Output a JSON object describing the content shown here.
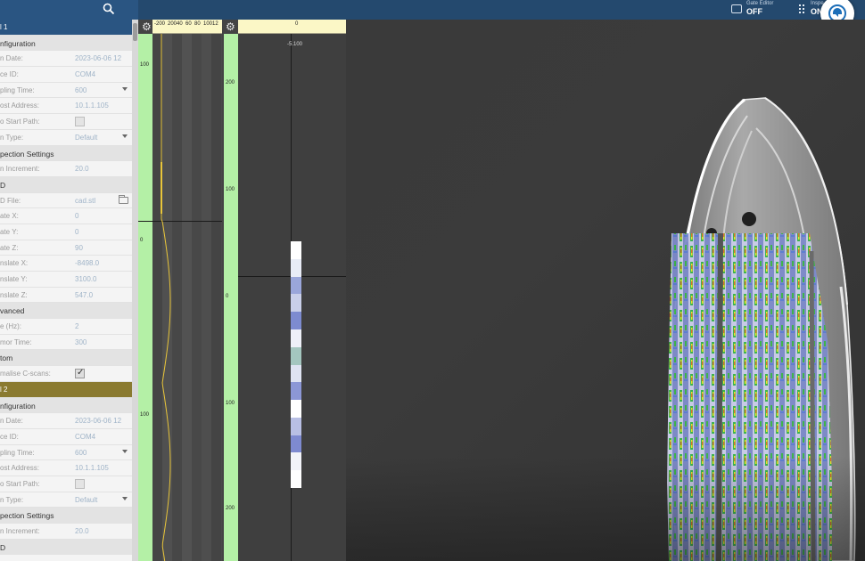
{
  "colors": {
    "topbar": "#24496e",
    "channel_header": "#2a5582",
    "channel_active": "#8a7a30",
    "ruler_h": "#fbf7c6",
    "ruler_v": "#b4f0a6",
    "viewport_bg": "#3a3a3a"
  },
  "toolbar": {
    "search_icon": "search-icon",
    "gate_editor_label": "Gate Editor",
    "gate_editor_value": "OFF",
    "grid_label": "Inspe",
    "grid_value": "ON",
    "assistant_icon": "assistant-chat-icon"
  },
  "panel": {
    "rows": [
      {
        "type": "channel",
        "label": "l 1"
      },
      {
        "type": "section",
        "label": "nfiguration"
      },
      {
        "type": "field",
        "label": "n Date:",
        "value": "2023-06-06 12"
      },
      {
        "type": "field",
        "label": "ce ID:",
        "value": "COM4"
      },
      {
        "type": "dropdown",
        "label": "pling Time:",
        "value": "600"
      },
      {
        "type": "field",
        "label": "ost Address:",
        "value": "10.1.1.105"
      },
      {
        "type": "checkbox",
        "label": "o Start Path:",
        "checked": false
      },
      {
        "type": "dropdown",
        "label": "n Type:",
        "value": "Default"
      },
      {
        "type": "section",
        "label": "pection Settings"
      },
      {
        "type": "field",
        "label": "n Increment:",
        "value": "20.0"
      },
      {
        "type": "section",
        "label": "D"
      },
      {
        "type": "file",
        "label": "D File:",
        "value": "cad.stl"
      },
      {
        "type": "field",
        "label": "ate X:",
        "value": "0"
      },
      {
        "type": "field",
        "label": "ate Y:",
        "value": "0"
      },
      {
        "type": "field",
        "label": "ate Z:",
        "value": "90"
      },
      {
        "type": "field",
        "label": "nslate X:",
        "value": "-8498.0"
      },
      {
        "type": "field",
        "label": "nslate Y:",
        "value": "3100.0"
      },
      {
        "type": "field",
        "label": "nslate Z:",
        "value": "547.0"
      },
      {
        "type": "section",
        "label": "vanced"
      },
      {
        "type": "field",
        "label": "e (Hz):",
        "value": "2"
      },
      {
        "type": "field",
        "label": "mor Time:",
        "value": "300"
      },
      {
        "type": "section",
        "label": "tom"
      },
      {
        "type": "checkbox",
        "label": "malise C-scans:",
        "checked": true
      },
      {
        "type": "channel_active",
        "label": "l 2"
      },
      {
        "type": "section",
        "label": "nfiguration"
      },
      {
        "type": "field",
        "label": "n Date:",
        "value": "2023-06-06 12"
      },
      {
        "type": "field",
        "label": "ce ID:",
        "value": "COM4"
      },
      {
        "type": "dropdown",
        "label": "pling Time:",
        "value": "600"
      },
      {
        "type": "field",
        "label": "ost Address:",
        "value": "10.1.1.105"
      },
      {
        "type": "checkbox",
        "label": "o Start Path:",
        "checked": false
      },
      {
        "type": "dropdown",
        "label": "n Type:",
        "value": "Default"
      },
      {
        "type": "section",
        "label": "pection Settings"
      },
      {
        "type": "field",
        "label": "n Increment:",
        "value": "20.0"
      },
      {
        "type": "section",
        "label": "D"
      }
    ]
  },
  "ascan": {
    "ruler_labels": [
      "-200",
      "200",
      "40",
      "60",
      "80",
      "100",
      "12"
    ],
    "vruler_labels": [
      "100",
      "0",
      "100"
    ]
  },
  "bscan": {
    "vruler_labels": [
      "200",
      "100",
      "0",
      "100",
      "200"
    ],
    "ruler_label": "0",
    "top_readout": "-5.100"
  }
}
